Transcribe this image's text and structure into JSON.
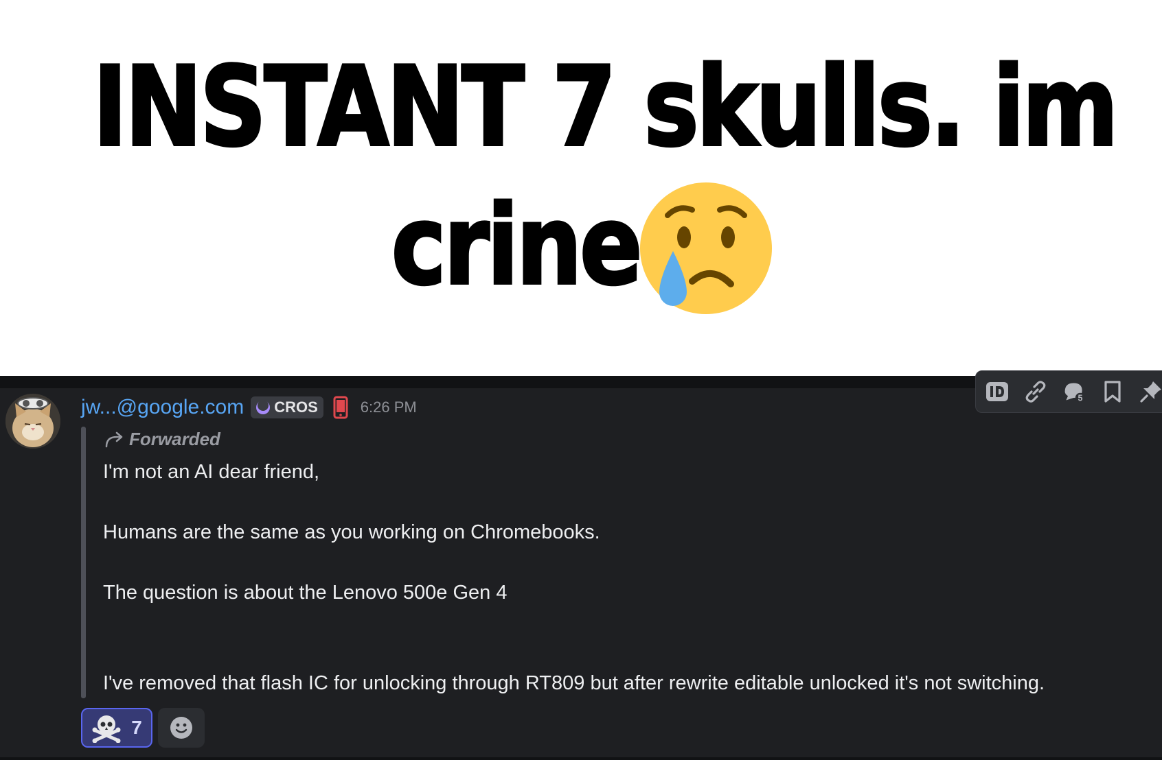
{
  "caption": {
    "line1": "INSTANT 7 skulls. im",
    "line2": "crine",
    "emoji": "crying-face"
  },
  "message": {
    "username": "jw...@google.com",
    "tag": "CROS",
    "device": "mobile-phone-icon",
    "timestamp": "6:26 PM",
    "forwarded_label": "Forwarded",
    "lines": [
      "I'm not an AI dear friend,",
      "Humans are the same as you working on Chromebooks.",
      "The question is about the Lenovo 500e Gen 4",
      "I've removed that flash IC for unlocking through RT809 but after rewrite editable unlocked it's not switching."
    ]
  },
  "reactions": [
    {
      "emoji": "skull-and-crossbones",
      "count": "7",
      "selected": true
    }
  ],
  "toolbar": [
    "copy-id-icon",
    "copy-link-icon",
    "create-thread-icon",
    "bookmark-icon",
    "pin-icon"
  ],
  "colors": {
    "chat_bg": "#1e1f22",
    "username": "#58a6f5",
    "text": "#eeeff1",
    "muted": "#8e9096",
    "reaction_bg": "#363a75",
    "reaction_border": "#5a66f0",
    "phone_icon": "#e0484e",
    "emoji_yellow": "#ffcc4d",
    "tear_blue": "#5dadec"
  }
}
